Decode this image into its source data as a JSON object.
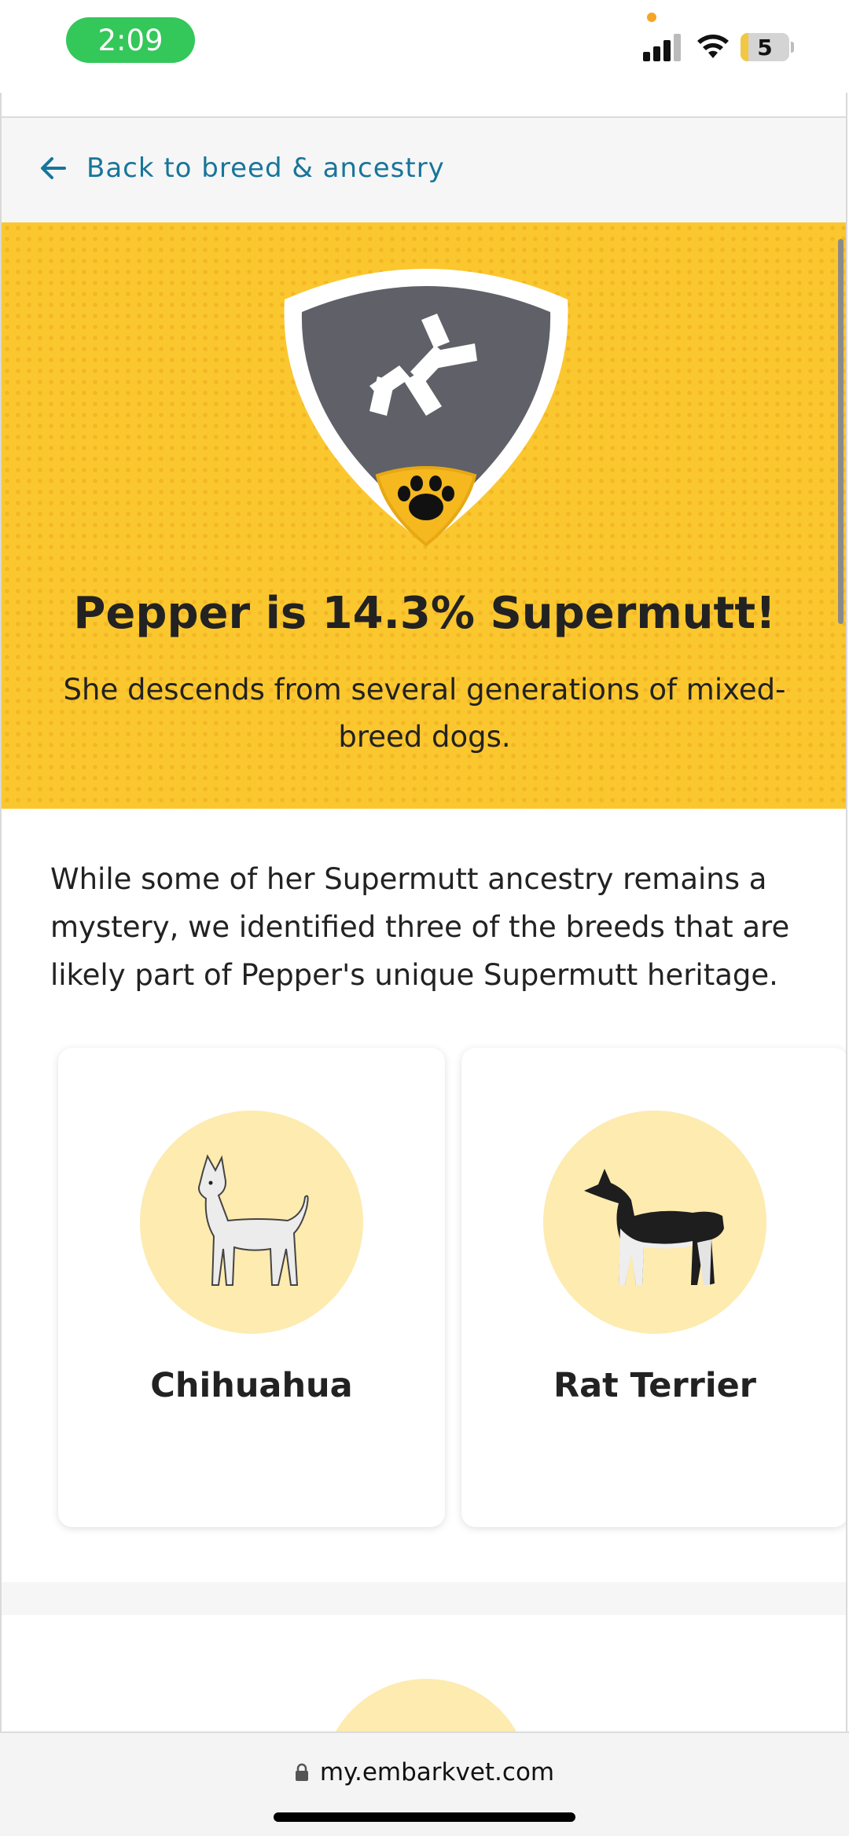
{
  "status_bar": {
    "time": "2:09",
    "battery": "5"
  },
  "nav": {
    "back_label": "Back to breed & ancestry"
  },
  "hero": {
    "title": "Pepper is 14.3% Supermutt!",
    "subtitle": "She descends from several generations of mixed-breed dogs."
  },
  "intro": "While some of her Supermutt ancestry remains a mystery, we identified three of the breeds that are likely part of Pepper's unique Supermutt heritage.",
  "breeds": [
    {
      "name": "Chihuahua"
    },
    {
      "name": "Rat Terrier"
    }
  ],
  "browser": {
    "url": "my.embarkvet.com"
  },
  "colors": {
    "hero_yellow": "#fbc72f",
    "shield_gray": "#5f6068",
    "link_blue": "#17759a",
    "breed_circle": "#fdebb0"
  }
}
